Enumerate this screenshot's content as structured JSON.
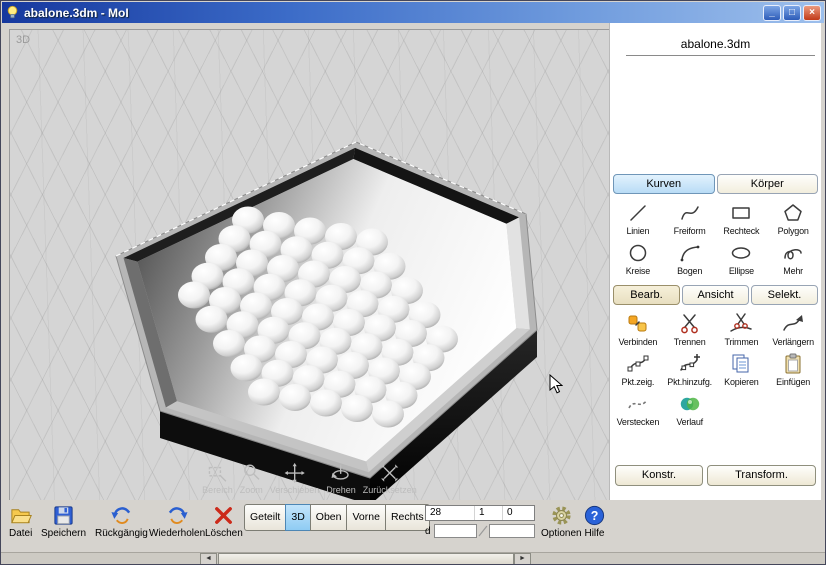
{
  "window": {
    "title": "abalone.3dm - MoI"
  },
  "titlebar_icons": {
    "minimize": "_",
    "maximize": "□",
    "close": "×"
  },
  "viewport": {
    "label": "3D",
    "nav": [
      "Bereich",
      "Zoom",
      "Verschieben",
      "Drehen",
      "Zurücksetzen"
    ]
  },
  "panel": {
    "title": "abalone.3dm",
    "tabs_create": [
      "Kurven",
      "Körper"
    ],
    "tools_create": [
      "Linien",
      "Freiform",
      "Rechteck",
      "Polygon",
      "Kreise",
      "Bogen",
      "Ellipse",
      "Mehr"
    ],
    "tabs_edit": [
      "Bearb.",
      "Ansicht",
      "Selekt."
    ],
    "tools_edit": [
      "Verbinden",
      "Trennen",
      "Trimmen",
      "Verlängern",
      "Pkt.zeig.",
      "Pkt.hinzufg.",
      "Kopieren",
      "Einfügen",
      "Verstecken",
      "Verlauf"
    ],
    "buttons": [
      "Konstr.",
      "Transform."
    ]
  },
  "toolbar": {
    "file": "Datei",
    "save": "Speichern",
    "undo": "Rückgängig",
    "redo": "Wiederholen",
    "delete": "Löschen",
    "views": [
      "Geteilt",
      "3D",
      "Oben",
      "Vorne",
      "Rechts"
    ],
    "active_view": "3D",
    "coord_x": "28",
    "coord_y": "1",
    "coord_z": "0",
    "d_label": "d",
    "options": "Optionen",
    "help": "Hilfe"
  },
  "scrollbar": {
    "left": "◄",
    "right": "►"
  },
  "icons": {
    "help_glyph": "?"
  },
  "colors": {
    "titlebar_blue": "#3c6cc8",
    "close_red": "#c13a18",
    "active_tab_blue": "#b9dcf6",
    "active_view_blue": "#8fccf3",
    "accent_orange": "#f5a623"
  }
}
